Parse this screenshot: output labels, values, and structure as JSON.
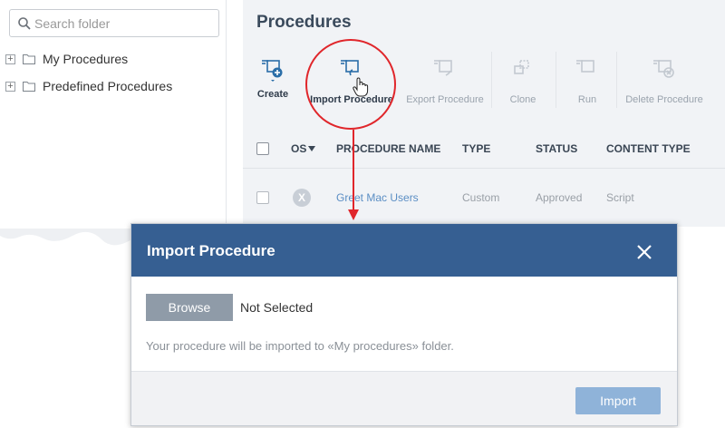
{
  "search": {
    "placeholder": "Search folder"
  },
  "tree": {
    "items": [
      {
        "label": "My Procedures",
        "expander": "+"
      },
      {
        "label": "Predefined Procedures",
        "expander": "+"
      }
    ]
  },
  "page": {
    "title": "Procedures"
  },
  "toolbar": {
    "create": "Create",
    "import": "Import Procedure",
    "export": "Export Procedure",
    "clone": "Clone",
    "run": "Run",
    "delete": "Delete Procedure"
  },
  "table": {
    "headers": {
      "os": "OS",
      "name": "PROCEDURE NAME",
      "type": "TYPE",
      "status": "STATUS",
      "content_type": "CONTENT TYPE"
    },
    "rows": [
      {
        "os": "X",
        "name": "Greet Mac Users",
        "type": "Custom",
        "status": "Approved",
        "content_type": "Script"
      }
    ]
  },
  "modal": {
    "title": "Import Procedure",
    "browse": "Browse",
    "file_status": "Not Selected",
    "hint": "Your procedure will be imported to «My procedures» folder.",
    "import": "Import"
  },
  "colors": {
    "modal_header": "#365f92",
    "highlight": "#e0262b",
    "link": "#5b8ec4",
    "import_button": "#8fb3d9",
    "browse_button": "#8f9ba8"
  },
  "icons": [
    "search-icon",
    "folder-icon",
    "create-icon",
    "import-icon",
    "export-icon",
    "clone-icon",
    "run-icon",
    "delete-icon",
    "close-icon",
    "sort-down-icon",
    "hand-cursor-icon"
  ]
}
